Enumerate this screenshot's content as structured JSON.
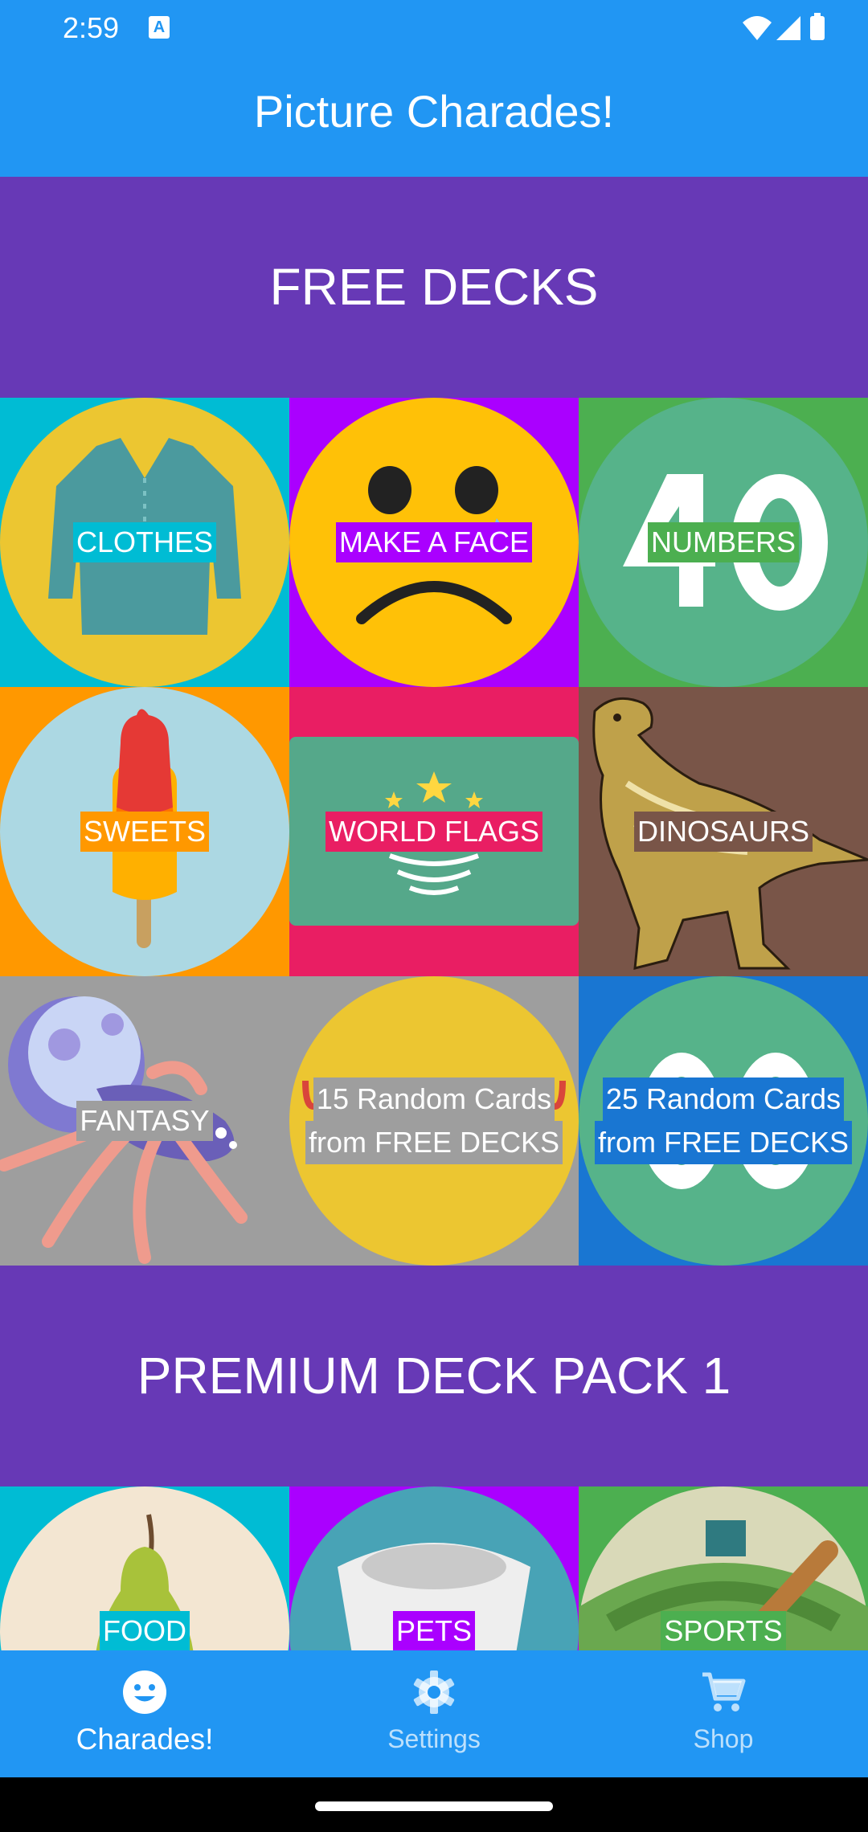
{
  "status_bar": {
    "time": "2:59",
    "notification_icon": "text-a-icon",
    "icons": [
      "wifi-icon",
      "signal-icon",
      "battery-icon"
    ]
  },
  "app_bar": {
    "title": "Picture Charades!"
  },
  "sections": {
    "free": {
      "title": "FREE DECKS"
    },
    "premium": {
      "title": "PREMIUM DECK PACK 1"
    }
  },
  "decks": {
    "clothes": {
      "label": "CLOTHES",
      "bg": "#00bcd4",
      "accent": "#00bcd4"
    },
    "make_a_face": {
      "label": "MAKE A FACE",
      "bg": "#aa00ff",
      "accent": "#aa00ff"
    },
    "numbers": {
      "label": "NUMBERS",
      "bg": "#4caf50",
      "accent": "#4caf50"
    },
    "sweets": {
      "label": "SWEETS",
      "bg": "#ff9800",
      "accent": "#ff9800"
    },
    "world_flags": {
      "label": "WORLD FLAGS",
      "bg": "#e91e63",
      "accent": "#e91e63"
    },
    "dinosaurs": {
      "label": "DINOSAURS",
      "bg": "#795548",
      "accent": "#795548"
    },
    "fantasy": {
      "label": "FANTASY",
      "bg": "#9e9e9e",
      "accent": "#9e9e9e"
    },
    "random15": {
      "line1": "15 Random Cards",
      "line2": "from FREE DECKS",
      "bg": "#9e9e9e",
      "accent": "#9e9e9e"
    },
    "random25": {
      "line1": "25 Random Cards",
      "line2": "from FREE DECKS",
      "bg": "#1976d2",
      "accent": "#1976d2"
    },
    "food": {
      "label": "FOOD",
      "bg": "#00bcd4",
      "accent": "#00bcd4"
    },
    "pets": {
      "label": "PETS",
      "bg": "#aa00ff",
      "accent": "#aa00ff"
    },
    "sports": {
      "label": "SPORTS",
      "bg": "#4caf50",
      "accent": "#4caf50"
    }
  },
  "bottom_nav": {
    "items": [
      {
        "label": "Charades!",
        "icon": "smiley-face-icon",
        "active": true
      },
      {
        "label": "Settings",
        "icon": "gear-icon",
        "active": false
      },
      {
        "label": "Shop",
        "icon": "shopping-cart-icon",
        "active": false
      }
    ]
  },
  "colors": {
    "primary": "#2196f3",
    "section_bg": "#6739b6"
  }
}
